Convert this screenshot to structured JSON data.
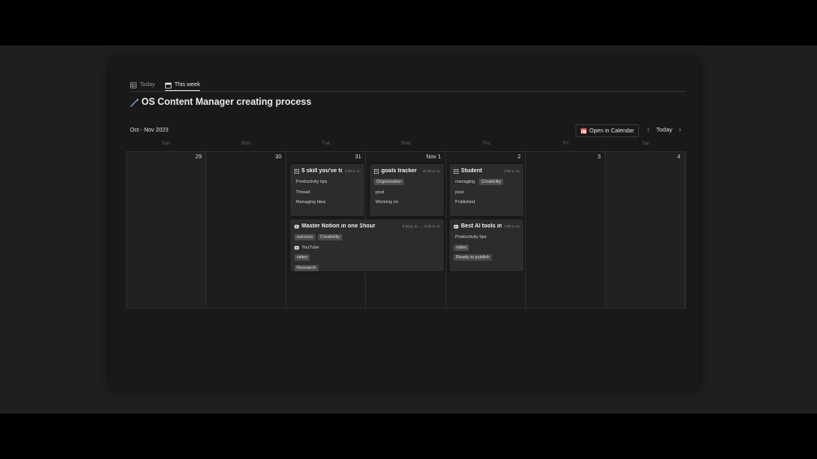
{
  "tabs": [
    {
      "label": "Today",
      "active": false,
      "icon": "table-icon"
    },
    {
      "label": "This week",
      "active": true,
      "icon": "calendar-icon"
    }
  ],
  "page_title": "OS Content Manager creating process",
  "title_icon": "pen-icon",
  "date_range": "Oct - Nov 2023",
  "open_calendar_label": "Open in Calendar",
  "today_label": "Today",
  "weekdays": [
    "Sun",
    "Mon",
    "Tue",
    "Wed",
    "Thu",
    "Fri",
    "Sat"
  ],
  "days": [
    "29",
    "30",
    "31",
    "Nov 1",
    "2",
    "3",
    "4"
  ],
  "events": {
    "skill": {
      "title": "5 skill you've to",
      "time": "3:00 a. m.",
      "p1": "Productivity tips",
      "p2": "Thread",
      "p3": "Managing Idea"
    },
    "goals": {
      "title": "goals tracker",
      "time": "11:00 a. m.",
      "p1": "Organization",
      "p2": "post",
      "p3": "Working on"
    },
    "student": {
      "title": "Student",
      "time": "3:00 a. m.",
      "p1a": "managing",
      "p1b": "Creativitiy",
      "p2": "post",
      "p3": "Published"
    },
    "notion": {
      "title": "Master Notion in one 1hour",
      "time": "5:00 p. m. → 3:45 a. m.",
      "p1a": "success",
      "p1b": "Creativitiy",
      "p2": "YouTube",
      "p3": "video",
      "p4": "Research"
    },
    "ai": {
      "title": "Best AI tools in",
      "time": "7:00 a. m.",
      "p1": "Productivity tips",
      "p2": "video",
      "p3": "Ready to publish"
    }
  },
  "colors": {
    "background": "#1f1f1f",
    "panel": "#191919",
    "card": "#2c2c2c",
    "tag": "#4a4a4a",
    "calendar_icon": "#e0504a"
  }
}
